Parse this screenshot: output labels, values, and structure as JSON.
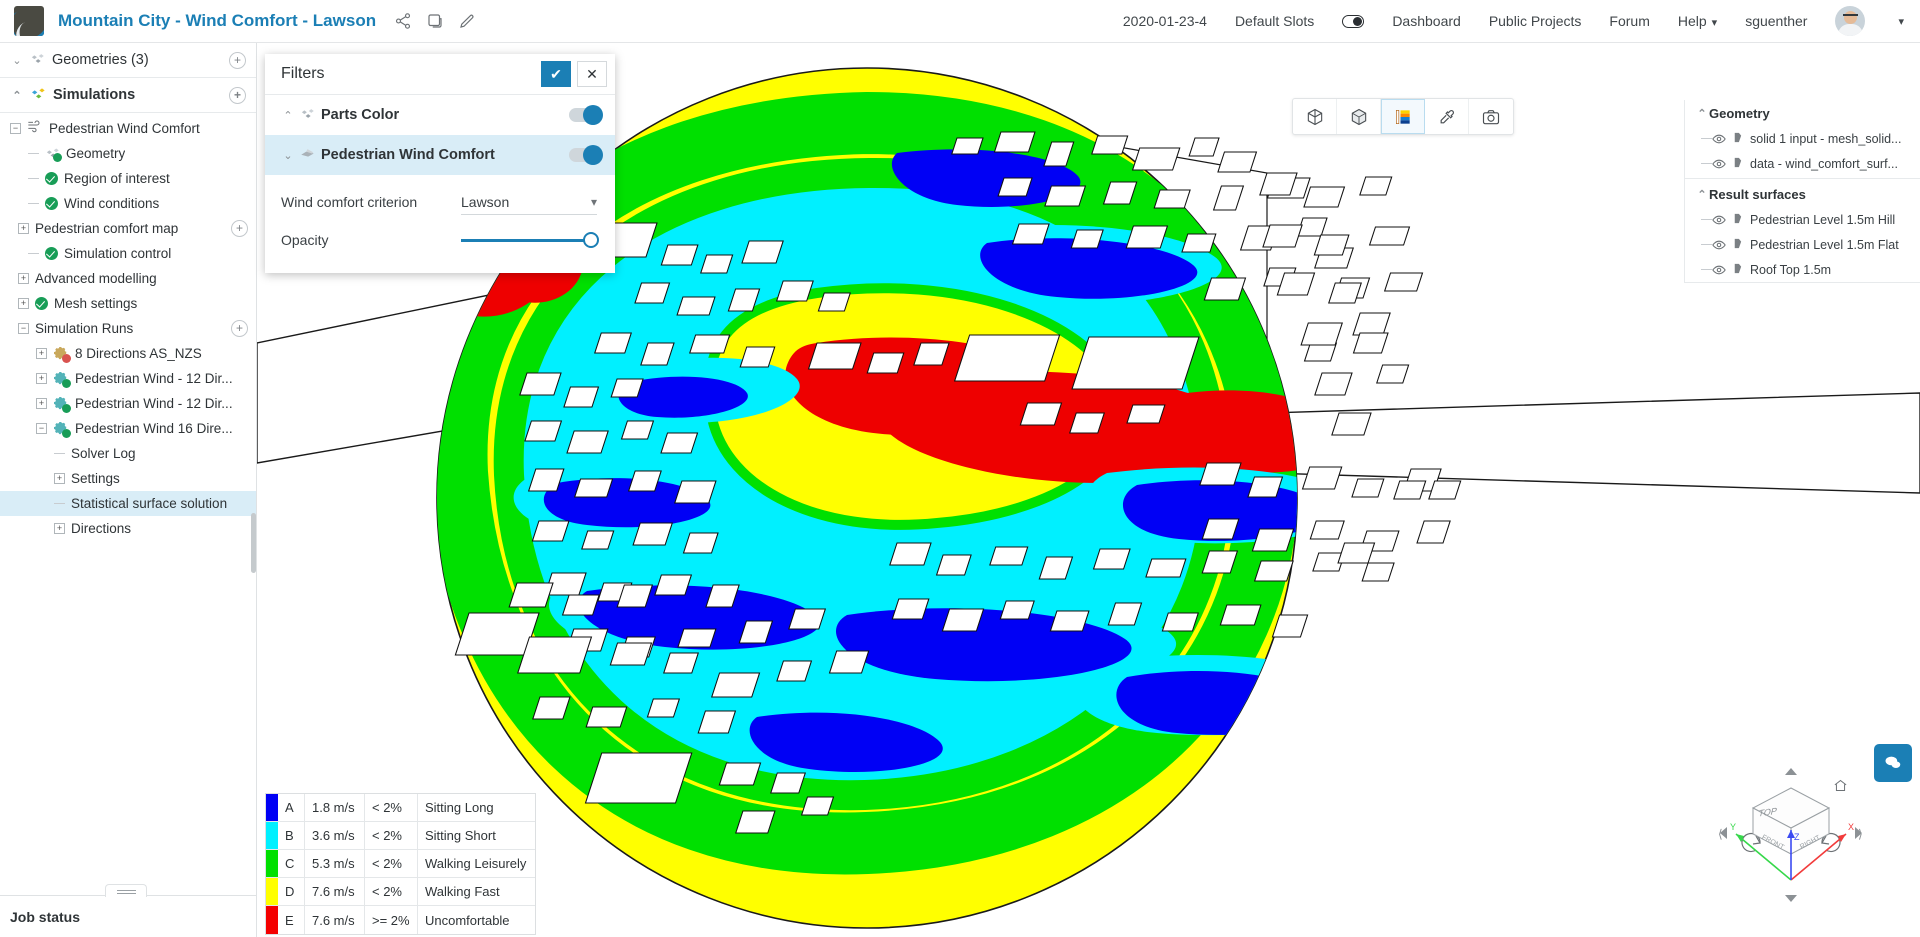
{
  "topbar": {
    "project_title": "Mountain City - Wind Comfort - Lawson",
    "icons": [
      "share-icon",
      "copy-icon",
      "edit-icon"
    ],
    "nav": [
      {
        "label": "2020-01-23-4",
        "name": "slot-date"
      },
      {
        "label": "Default Slots",
        "name": "default-slots"
      },
      {
        "label": "Dashboard",
        "name": "dashboard"
      },
      {
        "label": "Public Projects",
        "name": "public-projects"
      },
      {
        "label": "Forum",
        "name": "forum"
      },
      {
        "label": "Help",
        "name": "help"
      },
      {
        "label": "sguenther",
        "name": "username"
      }
    ]
  },
  "tree": {
    "geometries": {
      "label": "Geometries (3)",
      "twisty": "⌄",
      "plus": "+"
    },
    "simulations": {
      "label": "Simulations",
      "twisty": "⌃",
      "plus": "+"
    },
    "items": [
      {
        "label": "Pedestrian Wind Comfort",
        "indent": 10,
        "box": "−",
        "icon": "wind-icon",
        "name": "sim-pedestrian-wind-comfort"
      },
      {
        "label": "Geometry",
        "indent": 28,
        "box": "dash",
        "icon": "geometry-check-icon",
        "name": "sim-geometry"
      },
      {
        "label": "Region of interest",
        "indent": 28,
        "box": "dash",
        "icon": "check",
        "name": "sim-region-of-interest"
      },
      {
        "label": "Wind conditions",
        "indent": 28,
        "box": "dash",
        "icon": "check",
        "name": "sim-wind-conditions"
      },
      {
        "label": "Pedestrian comfort map",
        "indent": 18,
        "box": "+",
        "icon": "none",
        "plus": "+",
        "name": "sim-pedestrian-comfort-map"
      },
      {
        "label": "Simulation control",
        "indent": 28,
        "box": "dash",
        "icon": "check",
        "name": "sim-simulation-control"
      },
      {
        "label": "Advanced modelling",
        "indent": 18,
        "box": "+",
        "icon": "none",
        "name": "sim-advanced-modelling"
      },
      {
        "label": "Mesh settings",
        "indent": 18,
        "box": "+",
        "icon": "check",
        "name": "sim-mesh-settings"
      },
      {
        "label": "Simulation Runs",
        "indent": 18,
        "box": "−",
        "icon": "none",
        "plus": "+",
        "name": "sim-simulation-runs"
      },
      {
        "label": "8 Directions AS_NZS",
        "indent": 36,
        "box": "+",
        "icon": "gear-error",
        "name": "run-8-directions-as-nzs"
      },
      {
        "label": "Pedestrian Wind - 12 Dir...",
        "indent": 36,
        "box": "+",
        "icon": "gear-ok",
        "name": "run-pedestrian-wind-12-dir-a"
      },
      {
        "label": "Pedestrian Wind - 12 Dir...",
        "indent": 36,
        "box": "+",
        "icon": "gear-ok",
        "name": "run-pedestrian-wind-12-dir-b"
      },
      {
        "label": "Pedestrian Wind 16 Dire...",
        "indent": 36,
        "box": "−",
        "icon": "gear-ok",
        "name": "run-pedestrian-wind-16-dir"
      },
      {
        "label": "Solver Log",
        "indent": 54,
        "box": "dash",
        "icon": "none",
        "name": "run-solver-log"
      },
      {
        "label": "Settings",
        "indent": 54,
        "box": "+",
        "icon": "none",
        "name": "run-settings"
      },
      {
        "label": "Statistical surface solution",
        "indent": 54,
        "box": "dash",
        "icon": "none",
        "selected": true,
        "name": "run-statistical-surface-solution"
      },
      {
        "label": "Directions",
        "indent": 54,
        "box": "+",
        "icon": "none",
        "name": "run-directions"
      }
    ]
  },
  "filters": {
    "title": "Filters",
    "confirm_label": "✔",
    "close_label": "✕",
    "rows": [
      {
        "label": "Parts Color",
        "twisty": "⌃",
        "icon": "parts-icon",
        "enabled": true,
        "highlight": false,
        "name": "filter-parts-color"
      },
      {
        "label": "Pedestrian Wind Comfort",
        "twisty": "⌄",
        "icon": "surface-icon",
        "enabled": true,
        "highlight": true,
        "name": "filter-pedestrian-wind-comfort"
      }
    ],
    "criterion_label": "Wind comfort criterion",
    "criterion_value": "Lawson",
    "opacity_label": "Opacity",
    "opacity_value": 100
  },
  "viewport_toolbar": [
    {
      "name": "bounding-box-icon",
      "active": false
    },
    {
      "name": "solid-cube-icon",
      "active": false
    },
    {
      "name": "color-scale-icon",
      "active": true
    },
    {
      "name": "eyedropper-icon",
      "active": false
    },
    {
      "name": "camera-icon",
      "active": false
    }
  ],
  "right_panel": {
    "geometry_header": "Geometry",
    "geometry_items": [
      {
        "label": "solid 1 input - mesh_solid...",
        "name": "geom-solid-1-input"
      },
      {
        "label": "data - wind_comfort_surf...",
        "name": "geom-data-wind-comfort-surf"
      }
    ],
    "results_header": "Result surfaces",
    "results_items": [
      {
        "label": "Pedestrian Level 1.5m Hill",
        "name": "result-pedestrian-level-1-5m-hill"
      },
      {
        "label": "Pedestrian Level 1.5m Flat",
        "name": "result-pedestrian-level-1-5m-flat"
      },
      {
        "label": "Roof Top 1.5m",
        "name": "result-roof-top-1-5m"
      }
    ]
  },
  "legend": {
    "rows": [
      {
        "color": "#0000f5",
        "key": "A",
        "speed": "1.8 m/s",
        "freq": "< 2%",
        "desc": "Sitting Long"
      },
      {
        "color": "#00f0ff",
        "key": "B",
        "speed": "3.6 m/s",
        "freq": "< 2%",
        "desc": "Sitting Short"
      },
      {
        "color": "#00e000",
        "key": "C",
        "speed": "5.3 m/s",
        "freq": "< 2%",
        "desc": "Walking Leisurely"
      },
      {
        "color": "#ffff00",
        "key": "D",
        "speed": "7.6 m/s",
        "freq": "< 2%",
        "desc": "Walking Fast"
      },
      {
        "color": "#f40000",
        "key": "E",
        "speed": "7.6 m/s",
        "freq": ">= 2%",
        "desc": "Uncomfortable"
      }
    ]
  },
  "navcube": {
    "top_face": "TOP",
    "front_face": "FRONT",
    "right_face": "RIGHT",
    "axis_x": "X",
    "axis_y": "Y",
    "axis_z": "Z"
  },
  "statusbar": {
    "job_status": "Job status"
  },
  "colors": {
    "accent": "#1b7fb5",
    "selection": "#d9edf7",
    "ok_green": "#189d57",
    "error_red": "#d9534f"
  }
}
